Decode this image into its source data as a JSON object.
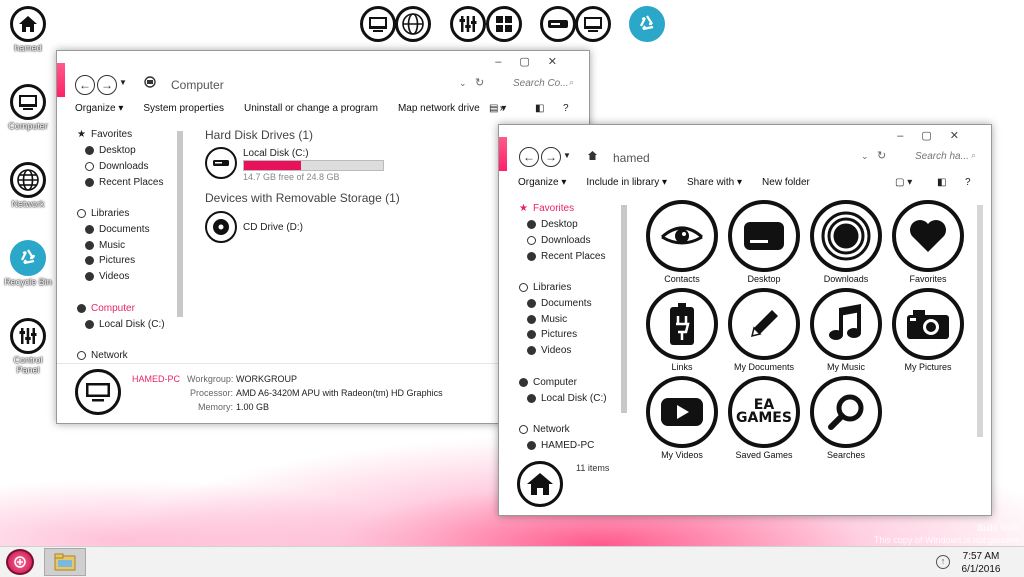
{
  "desktop": {
    "icons": [
      "hamed",
      "Computer",
      "Network",
      "Recycle Bin",
      "Control Panel"
    ],
    "watermark": [
      "Build 9600",
      "This copy of Windows is not genuine"
    ]
  },
  "top_icons": [
    "computer-icon",
    "globe-icon",
    "control-panel-icon",
    "tiles-icon",
    "drive-icon",
    "computer-icon",
    "recycle-icon"
  ],
  "win1": {
    "address": "Computer",
    "search": "Search Co...",
    "toolbar": [
      "Organize ▾",
      "System properties",
      "Uninstall or change a program",
      "Map network drive",
      "»"
    ],
    "nav": {
      "favorites": "Favorites",
      "desktop": "Desktop",
      "downloads": "Downloads",
      "recent": "Recent Places",
      "libraries": "Libraries",
      "documents": "Documents",
      "music": "Music",
      "pictures": "Pictures",
      "videos": "Videos",
      "computer": "Computer",
      "localdisk": "Local Disk (C:)",
      "network": "Network"
    },
    "hdd_header": "Hard Disk Drives (1)",
    "disk_name": "Local Disk (C:)",
    "disk_free": "14.7 GB free of 24.8 GB",
    "disk_used_fraction": 0.41,
    "removable_header": "Devices with Removable Storage (1)",
    "cd_name": "CD Drive (D:)",
    "details": {
      "pc_name": "HAMED-PC",
      "workgroup_label": "Workgroup:",
      "workgroup": "WORKGROUP",
      "processor_label": "Processor:",
      "processor": "AMD A6-3420M APU with Radeon(tm) HD Graphics",
      "memory_label": "Memory:",
      "memory": "1.00 GB"
    }
  },
  "win2": {
    "address": "hamed",
    "search": "Search ha...",
    "toolbar": [
      "Organize ▾",
      "Include in library ▾",
      "Share with ▾",
      "New folder"
    ],
    "nav": {
      "favorites": "Favorites",
      "desktop": "Desktop",
      "downloads": "Downloads",
      "recent": "Recent Places",
      "libraries": "Libraries",
      "documents": "Documents",
      "music": "Music",
      "pictures": "Pictures",
      "videos": "Videos",
      "computer": "Computer",
      "localdisk": "Local Disk (C:)",
      "network": "Network",
      "hamedpc": "HAMED-PC"
    },
    "folders": [
      "Contacts",
      "Desktop",
      "Downloads",
      "Favorites",
      "Links",
      "My Documents",
      "My Music",
      "My Pictures",
      "My Videos",
      "Saved Games",
      "Searches"
    ],
    "ea_text": "EA\nGAMES",
    "items_count": "11 items"
  },
  "taskbar": {
    "time": "7:57 AM",
    "date": "6/1/2016"
  },
  "colors": {
    "accent": "#ff2a6d",
    "recycle": "#2aa7c9"
  }
}
